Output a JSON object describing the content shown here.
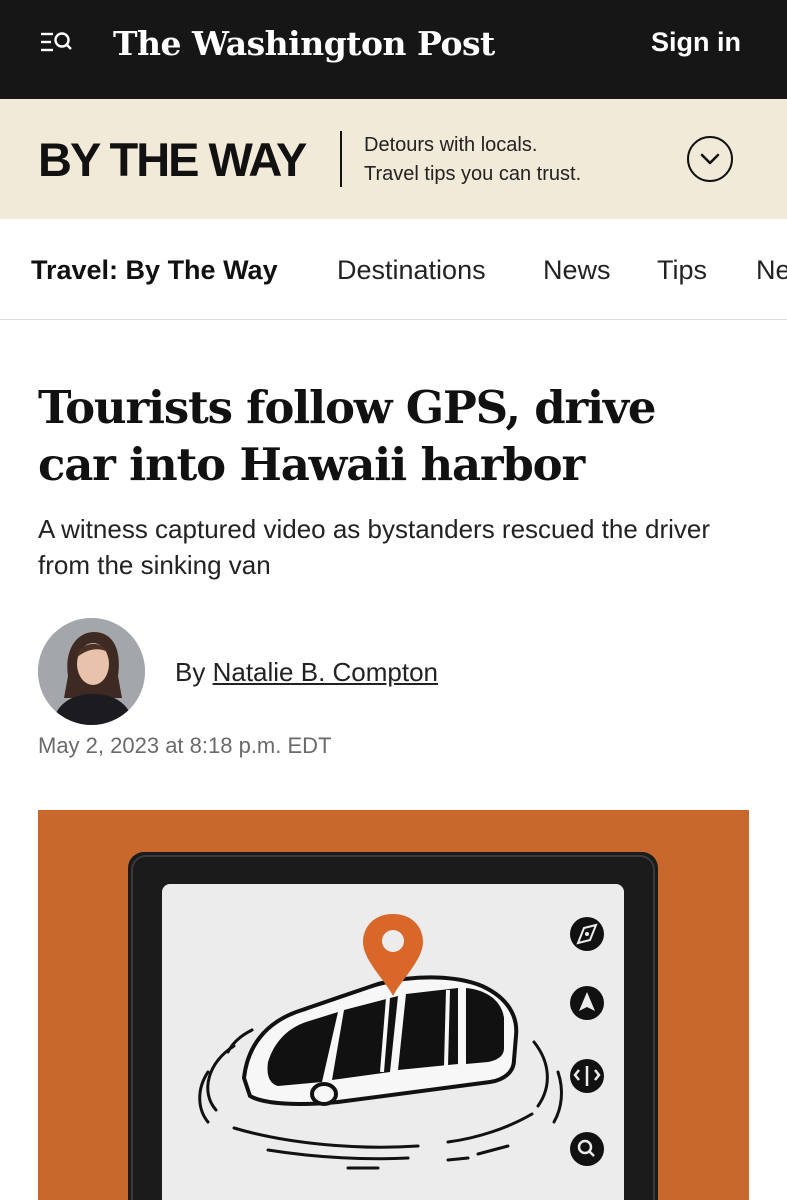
{
  "header": {
    "menu_icon": "menu-search-icon",
    "masthead": "The Washington Post",
    "signin_label": "Sign in"
  },
  "section_banner": {
    "logo_text": "BY THE WAY",
    "tagline_line1": "Detours with locals.",
    "tagline_line2": "Travel tips you can trust.",
    "expand_icon": "chevron-down-circle-icon"
  },
  "nav": {
    "items": [
      {
        "label": "Travel: By The Way",
        "current": true
      },
      {
        "label": "Destinations"
      },
      {
        "label": "News"
      },
      {
        "label": "Tips"
      },
      {
        "label": "Ne"
      }
    ]
  },
  "article": {
    "headline": "Tourists follow GPS, drive car into Hawaii harbor",
    "dek": "A witness captured video as bystanders rescued the driver from the sinking van",
    "byline_prefix": "By",
    "author": "Natalie B. Compton",
    "timestamp": "May 2, 2023 at 8:18 p.m. EDT",
    "image_icons": [
      "compass-icon",
      "navigation-arrow-icon",
      "directions-icon",
      "location-search-icon"
    ]
  },
  "colors": {
    "topbar": "#161616",
    "banner": "#f2ead9",
    "illustration_bg": "#c9682c",
    "pin": "#d9672a"
  }
}
